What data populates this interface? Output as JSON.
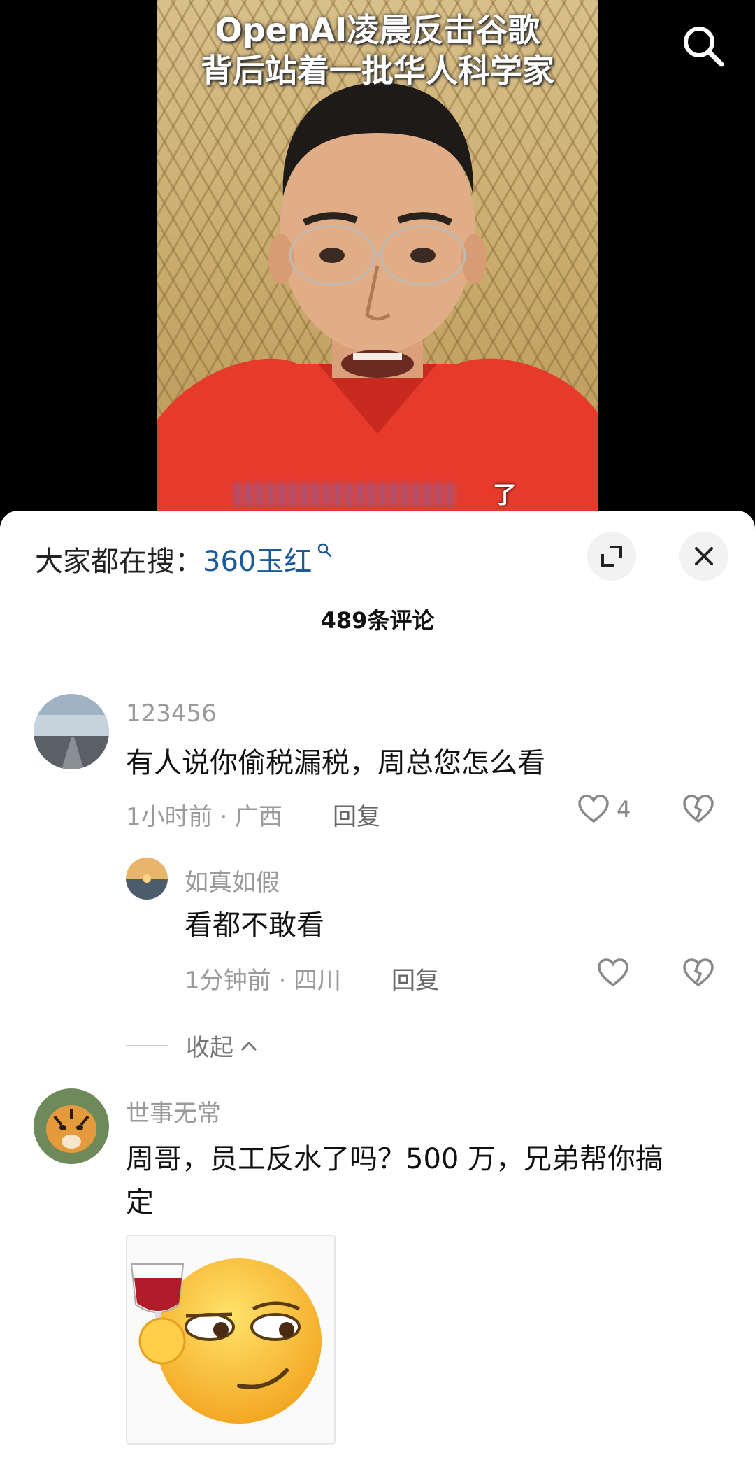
{
  "video": {
    "title_line1": "OpenAI凌晨反击谷歌",
    "title_line2": "背后站着一批华人科学家",
    "subtitle_tail": "了"
  },
  "sheet": {
    "hot_search_prefix": "大家都在搜：",
    "hot_search_keyword": "360玉红",
    "comment_count": "489条评论",
    "collapse_label": "收起"
  },
  "comments": [
    {
      "username": "123456",
      "text": "有人说你偷税漏税，周总您怎么看",
      "meta": "1小时前 · 广西",
      "reply_label": "回复",
      "likes": "4"
    },
    {
      "username": "如真如假",
      "text": "看都不敢看",
      "meta": "1分钟前 · 四川",
      "reply_label": "回复",
      "likes": ""
    },
    {
      "username": "世事无常",
      "text_line1": "周哥，员工反水了吗？500 万，兄弟帮你搞",
      "text_line2": "定"
    }
  ],
  "icons": {
    "search": "search-icon",
    "expand": "expand-icon",
    "close": "close-icon",
    "heart": "heart-icon",
    "broken_heart": "broken-heart-icon",
    "chevron_up": "chevron-up-icon"
  },
  "colors": {
    "keyword": "#1a5a9a",
    "meta_gray": "#9a9a9a",
    "sheet_bg": "#ffffff"
  }
}
